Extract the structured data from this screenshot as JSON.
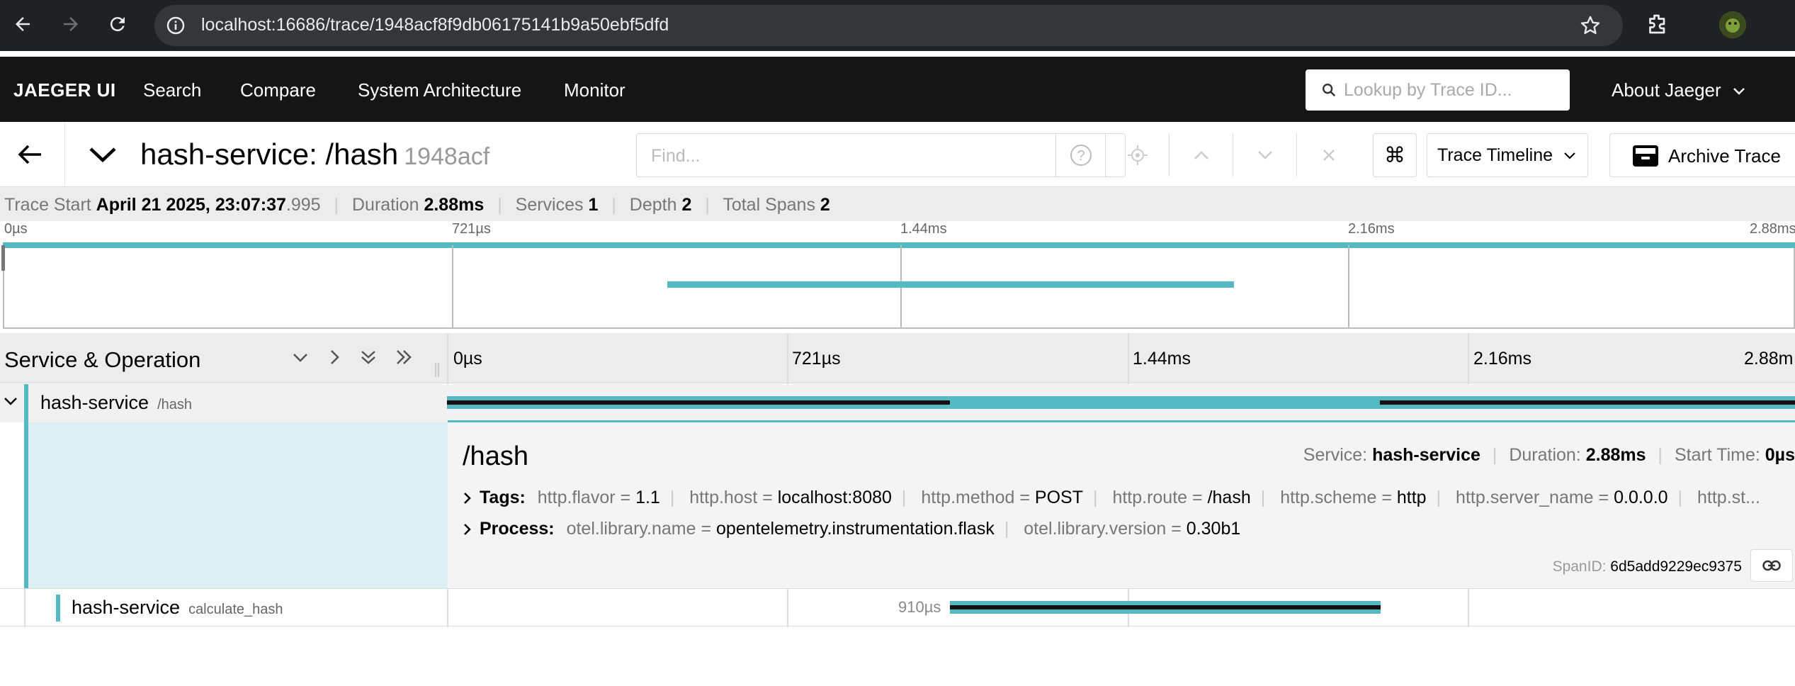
{
  "browser": {
    "url": "localhost:16686/trace/1948acf8f9db06175141b9a50ebf5dfd"
  },
  "topnav": {
    "brand": "JAEGER UI",
    "menu": [
      "Search",
      "Compare",
      "System Architecture",
      "Monitor"
    ],
    "lookup_placeholder": "Lookup by Trace ID...",
    "about": "About Jaeger"
  },
  "trace": {
    "title": "hash-service: /hash",
    "short_id": "1948acf",
    "find_placeholder": "Find...",
    "view_mode": "Trace Timeline",
    "archive_label": "Archive Trace"
  },
  "summary": {
    "start_label": "Trace Start",
    "start_value": "April 21 2025, 23:07:37",
    "start_ms": ".995",
    "duration_label": "Duration",
    "duration_value": "2.88ms",
    "services_label": "Services",
    "services_value": "1",
    "depth_label": "Depth",
    "depth_value": "2",
    "total_spans_label": "Total Spans",
    "total_spans_value": "2"
  },
  "minimap_ticks": [
    "0µs",
    "721µs",
    "1.44ms",
    "2.16ms",
    "2.88ms"
  ],
  "timeline": {
    "header_title": "Service & Operation",
    "ticks": [
      "0µs",
      "721µs",
      "1.44ms",
      "2.16ms",
      "2.88m"
    ]
  },
  "spans": [
    {
      "service": "hash-service",
      "operation": "/hash"
    },
    {
      "service": "hash-service",
      "operation": "calculate_hash",
      "duration_label": "910µs"
    }
  ],
  "detail": {
    "operation": "/hash",
    "service_label": "Service:",
    "service_value": "hash-service",
    "duration_label": "Duration:",
    "duration_value": "2.88ms",
    "start_label": "Start Time:",
    "start_value": "0µs",
    "tags_label": "Tags:",
    "tags": [
      {
        "key": "http.flavor",
        "value": "1.1"
      },
      {
        "key": "http.host",
        "value": "localhost:8080"
      },
      {
        "key": "http.method",
        "value": "POST"
      },
      {
        "key": "http.route",
        "value": "/hash"
      },
      {
        "key": "http.scheme",
        "value": "http"
      },
      {
        "key": "http.server_name",
        "value": "0.0.0.0"
      }
    ],
    "tags_truncated": "http.st...",
    "process_label": "Process:",
    "process": [
      {
        "key": "otel.library.name",
        "value": "opentelemetry.instrumentation.flask"
      },
      {
        "key": "otel.library.version",
        "value": "0.30b1"
      }
    ],
    "span_id_label": "SpanID:",
    "span_id_value": "6d5add9229ec9375"
  },
  "colors": {
    "accent": "#54b9c2",
    "nav_bg": "#151515",
    "chrome_bg": "#202124"
  }
}
